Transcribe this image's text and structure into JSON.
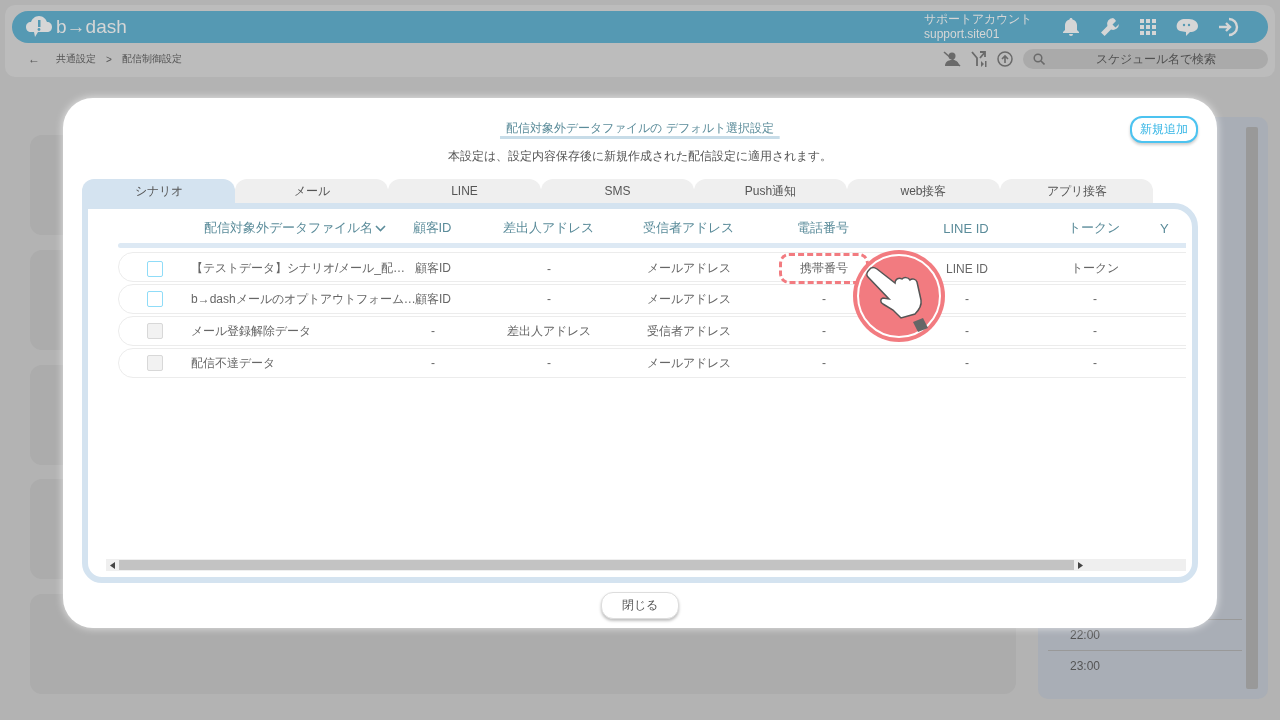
{
  "header": {
    "logo": "b→dash",
    "account_name": "サポートアカウント",
    "account_id": "support.site01"
  },
  "breadcrumb": {
    "back": "←",
    "items": [
      "共通設定",
      "配信制御設定"
    ],
    "separator": ">"
  },
  "search": {
    "placeholder": "スケジュール名で検索"
  },
  "background_times": [
    "22:00",
    "23:00"
  ],
  "dialog": {
    "title": "配信対象外データファイルの デフォルト選択設定",
    "subtitle": "本設定は、設定内容保存後に新規作成された配信設定に適用されます。",
    "add_button": "新規追加",
    "tabs": [
      {
        "label": "シナリオ",
        "selected": true
      },
      {
        "label": "メール",
        "selected": false
      },
      {
        "label": "LINE",
        "selected": false
      },
      {
        "label": "SMS",
        "selected": false
      },
      {
        "label": "Push通知",
        "selected": false
      },
      {
        "label": "web接客",
        "selected": false
      },
      {
        "label": "アプリ接客",
        "selected": false
      }
    ],
    "table": {
      "columns": [
        {
          "label": "配信対象外データファイル名",
          "sortable": true
        },
        {
          "label": "顧客ID",
          "sortable": false
        },
        {
          "label": "差出人アドレス",
          "sortable": false
        },
        {
          "label": "受信者アドレス",
          "sortable": false
        },
        {
          "label": "電話番号",
          "sortable": false
        },
        {
          "label": "LINE ID",
          "sortable": false
        },
        {
          "label": "トークン",
          "sortable": false
        },
        {
          "label": "Y",
          "sortable": false
        }
      ],
      "rows": [
        {
          "checked": false,
          "disabled": false,
          "cells": [
            {
              "text": "【テストデータ】シナリオ/メール_配…",
              "highlighted": false
            },
            {
              "text": "顧客ID",
              "highlighted": false
            },
            {
              "text": "-",
              "highlighted": false
            },
            {
              "text": "メールアドレス",
              "highlighted": false
            },
            {
              "text": "携帯番号",
              "highlighted": true
            },
            {
              "text": "LINE ID",
              "highlighted": false
            },
            {
              "text": "トークン",
              "highlighted": false
            }
          ]
        },
        {
          "checked": false,
          "disabled": false,
          "cells": [
            {
              "text": "b→dashメールのオプトアウトフォーム…",
              "highlighted": false
            },
            {
              "text": "顧客ID",
              "highlighted": false
            },
            {
              "text": "-",
              "highlighted": false
            },
            {
              "text": "メールアドレス",
              "highlighted": false
            },
            {
              "text": "-",
              "highlighted": false
            },
            {
              "text": "-",
              "highlighted": false
            },
            {
              "text": "-",
              "highlighted": false
            }
          ]
        },
        {
          "checked": false,
          "disabled": true,
          "cells": [
            {
              "text": "メール登録解除データ",
              "highlighted": false
            },
            {
              "text": "-",
              "highlighted": false
            },
            {
              "text": "差出人アドレス",
              "highlighted": false
            },
            {
              "text": "受信者アドレス",
              "highlighted": false
            },
            {
              "text": "-",
              "highlighted": false
            },
            {
              "text": "-",
              "highlighted": false
            },
            {
              "text": "-",
              "highlighted": false
            }
          ]
        },
        {
          "checked": false,
          "disabled": true,
          "cells": [
            {
              "text": "配信不達データ",
              "highlighted": false
            },
            {
              "text": "-",
              "highlighted": false
            },
            {
              "text": "-",
              "highlighted": false
            },
            {
              "text": "メールアドレス",
              "highlighted": false
            },
            {
              "text": "-",
              "highlighted": false
            },
            {
              "text": "-",
              "highlighted": false
            },
            {
              "text": "-",
              "highlighted": false
            }
          ]
        }
      ]
    },
    "close_button": "閉じる"
  }
}
